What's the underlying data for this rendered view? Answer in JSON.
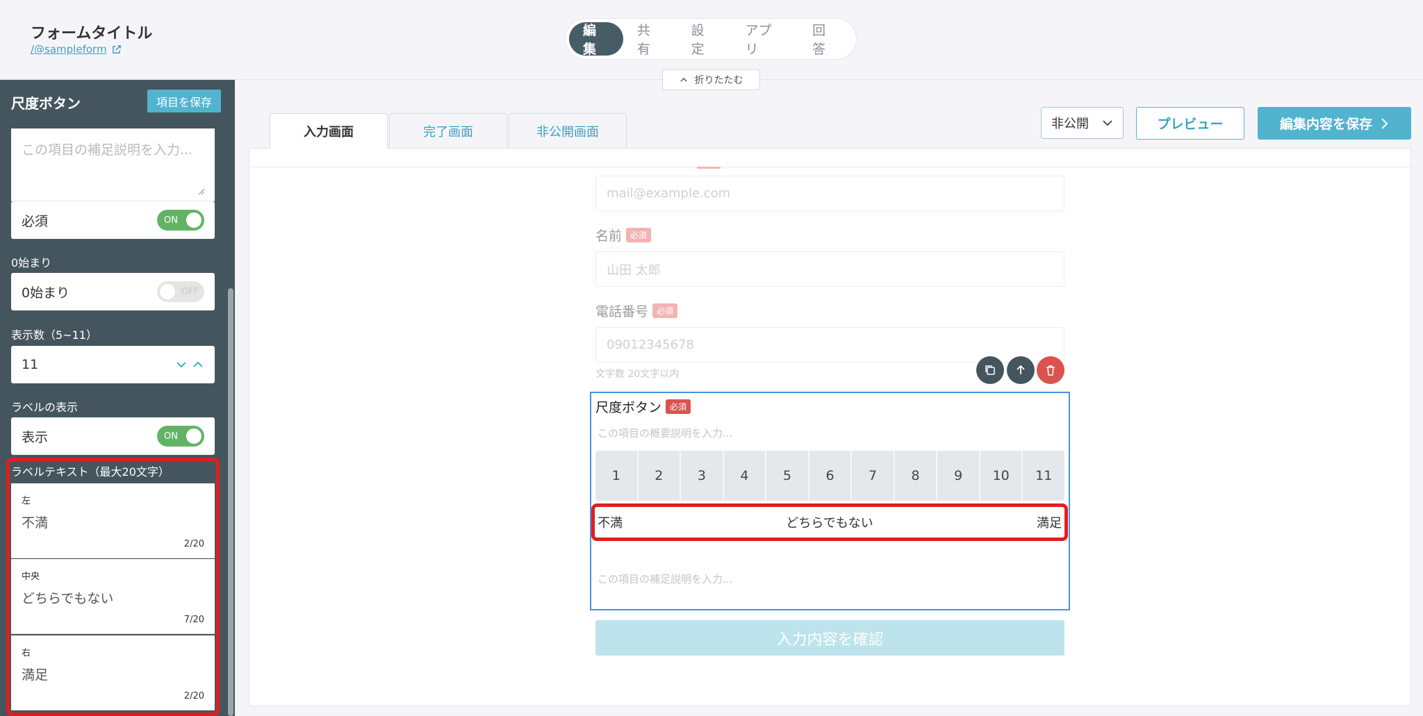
{
  "header": {
    "form_title": "フォームタイトル",
    "form_url": "/@sampleform",
    "tabs": [
      "編集",
      "共有",
      "設定",
      "アプリ",
      "回答"
    ],
    "collapse_label": "折りたたむ"
  },
  "sidebar": {
    "title": "尺度ボタン",
    "save_button": "項目を保存",
    "supplement_placeholder": "この項目の補足説明を入力...",
    "required_label": "必須",
    "required_toggle": "ON",
    "zero_start_section": "0始まり",
    "zero_start_label": "0始まり",
    "zero_start_toggle": "OFF",
    "count_section": "表示数（5~11）",
    "count_value": "11",
    "show_label_section": "ラベルの表示",
    "show_label_label": "表示",
    "show_label_toggle": "ON",
    "label_text_section": "ラベルテキスト（最大20文字）",
    "labels": [
      {
        "position": "左",
        "value": "不満",
        "count": "2/20"
      },
      {
        "position": "中央",
        "value": "どちらでもない",
        "count": "7/20"
      },
      {
        "position": "右",
        "value": "満足",
        "count": "2/20"
      }
    ]
  },
  "toolbar": {
    "visibility": "非公開",
    "preview": "プレビュー",
    "save_edits": "編集内容を保存"
  },
  "screen_tabs": [
    "入力画面",
    "完了画面",
    "非公開画面"
  ],
  "form": {
    "email_placeholder": "mail@example.com",
    "name_label": "名前",
    "name_placeholder": "山田 太郎",
    "phone_label": "電話番号",
    "phone_placeholder": "09012345678",
    "phone_hint": "文字数 20文字以内",
    "required_badge": "必須",
    "scale": {
      "title": "尺度ボタン",
      "description_placeholder": "この項目の概要説明を入力...",
      "buttons": [
        "1",
        "2",
        "3",
        "4",
        "5",
        "6",
        "7",
        "8",
        "9",
        "10",
        "11"
      ],
      "label_left": "不満",
      "label_center": "どちらでもない",
      "label_right": "満足",
      "supplement_placeholder": "この項目の補足説明を入力..."
    },
    "confirm_button": "入力内容を確認"
  },
  "colors": {
    "accent": "#52b3cf",
    "sidebar_bg": "#44555e",
    "toggle_on": "#62b464",
    "highlight": "#e01e1e",
    "required": "#d9534f"
  }
}
